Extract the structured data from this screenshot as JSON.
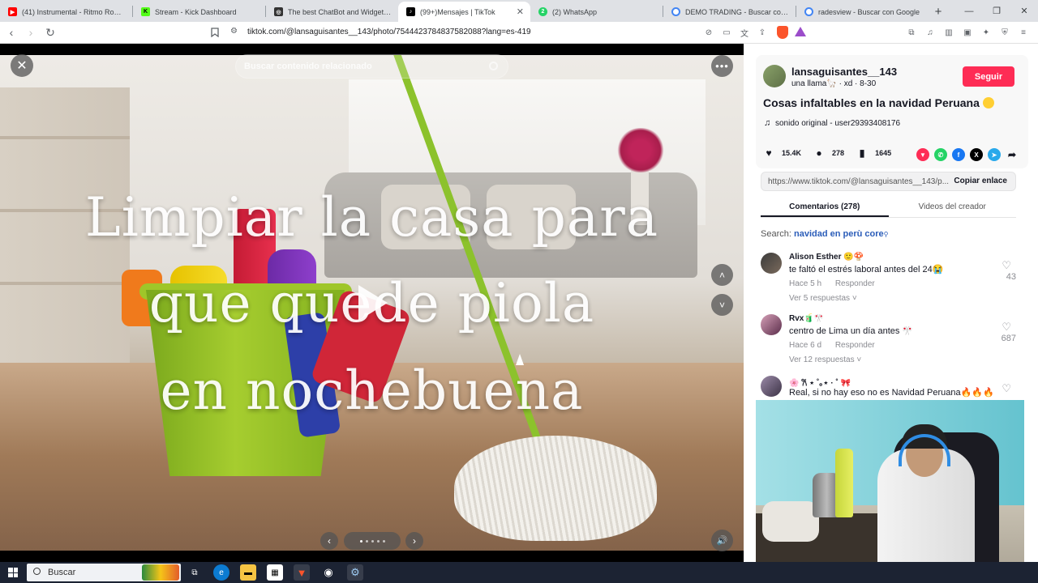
{
  "browser": {
    "tabs": [
      {
        "title": "(41) Instrumental - Ritmo Romantico",
        "favicon_color": "#ff0000",
        "favicon_name": "youtube-icon"
      },
      {
        "title": "Stream - Kick Dashboard",
        "favicon_color": "#53fc18",
        "favicon_name": "kick-icon"
      },
      {
        "title": "The best ChatBot and Widgets for Kick",
        "favicon_color": "#333333",
        "favicon_name": "chatbot-icon"
      },
      {
        "title": "(99+)Mensajes | TikTok",
        "favicon_color": "#000000",
        "favicon_name": "tiktok-icon",
        "active": true
      },
      {
        "title": "(2) WhatsApp",
        "favicon_color": "#25d366",
        "favicon_name": "whatsapp-icon"
      },
      {
        "title": "DEMO TRADING - Buscar con Google",
        "favicon_color": "#4285f4",
        "favicon_name": "google-icon"
      },
      {
        "title": "radesview - Buscar con Google",
        "favicon_color": "#4285f4",
        "favicon_name": "google-icon"
      }
    ],
    "url": "tiktok.com/@lansaguisantes__143/photo/7544423784837582088?lang=es-419"
  },
  "viewer": {
    "search_placeholder": "Buscar contenido relacionado",
    "overlay_lines": [
      "Limpiar la casa para",
      "que quede piola",
      "en nochebuena"
    ],
    "carousel_dot_count": 5,
    "carousel_active_dot": 1
  },
  "post": {
    "username": "lansaguisantes__143",
    "subtitle": "una llama🦙 · xd · 8-30",
    "follow_label": "Seguir",
    "title": "Cosas infaltables en la navidad Peruana",
    "sound": "sonido original - user29393408176",
    "likes": "15.4K",
    "comments": "278",
    "saves": "1645",
    "share_link": "https://www.tiktok.com/@lansaguisantes__143/p...",
    "copy_label": "Copiar enlace",
    "tab_comments": "Comentarios (278)",
    "tab_videos": "Videos del creador",
    "search_prefix": "Search:",
    "search_query": "navidad en perù core",
    "accent": "#fe2c55"
  },
  "comments": [
    {
      "name": "Alison Esther 🙂🍄",
      "text": "te faltó el estrés laboral antes del 24😭",
      "time": "Hace 5 h",
      "reply": "Responder",
      "replies": "Ver 5 respuestas",
      "likes": "43"
    },
    {
      "name": "Rvx🧃🎌",
      "text": "centro de Lima un día antes 🎌",
      "time": "Hace 6 d",
      "reply": "Responder",
      "replies": "Ver 12 respuestas",
      "likes": "687"
    },
    {
      "name": "🌸 𐙚 ⋆ ˚｡⋆ ·  ˚ 🎀",
      "text": "Real, si no hay eso no es Navidad Peruana🔥🔥🔥",
      "time": "",
      "reply": "",
      "replies": "",
      "likes": ""
    }
  ],
  "taskbar": {
    "search_label": "Buscar"
  }
}
